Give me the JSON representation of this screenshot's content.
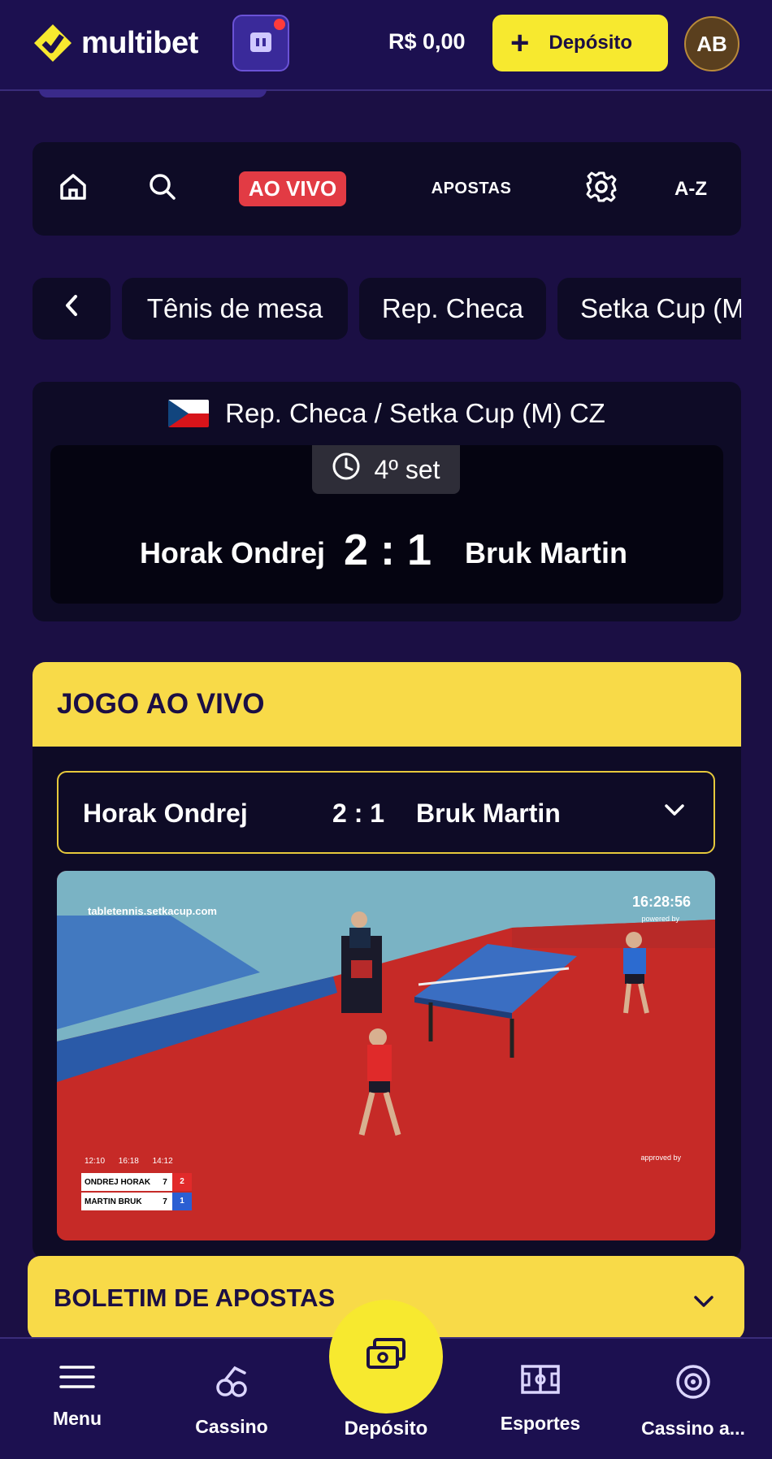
{
  "header": {
    "logo_text": "multibet",
    "balance": "R$ 0,00",
    "deposit_label": "Depósito",
    "avatar_initials": "AB",
    "accent_color": "#f7e92f",
    "background_color": "#1c1050"
  },
  "sports_nav": {
    "items": [
      {
        "icon": "home-icon"
      },
      {
        "icon": "search-icon"
      },
      {
        "label": "AO VIVO"
      },
      {
        "label": "APOSTAS"
      },
      {
        "icon": "gear-icon"
      },
      {
        "label": "A-Z"
      }
    ]
  },
  "breadcrumb": {
    "back_icon": "chevron-left-icon",
    "items": [
      "Tênis de mesa",
      "Rep. Checa",
      "Setka Cup (M"
    ]
  },
  "match": {
    "league": "Rep. Checa / Setka Cup (M) CZ",
    "flag": "czech-flag",
    "period": "4º set",
    "home": "Horak Ondrej",
    "score": "2 : 1",
    "away": "Bruk Martin"
  },
  "live_game": {
    "title": "JOGO AO VIVO",
    "selector": {
      "home": "Horak Ondrej",
      "score": "2 : 1",
      "away": "Bruk Martin"
    },
    "video": {
      "site": "tabletennis.setkacup.com",
      "clock": "16:28:56",
      "powered_by": "powered by",
      "approved_by": "approved by",
      "set_times": "12:10 16:18 14:12",
      "rows": [
        {
          "name": "ONDREJ HORAK",
          "games": "7",
          "sets": "2"
        },
        {
          "name": "MARTIN BRUK",
          "games": "7",
          "sets": "1"
        }
      ]
    }
  },
  "bet_slip": {
    "label": "BOLETIM DE APOSTAS"
  },
  "bottom_nav": {
    "items": [
      {
        "label": "Menu",
        "icon": "menu-icon"
      },
      {
        "label": "Cassino",
        "icon": "cassino-icon"
      },
      {
        "label": "Depósito",
        "icon": "deposit-icon"
      },
      {
        "label": "Esportes",
        "icon": "sports-icon"
      },
      {
        "label": "Cassino a...",
        "icon": "live-casino-icon"
      }
    ]
  }
}
